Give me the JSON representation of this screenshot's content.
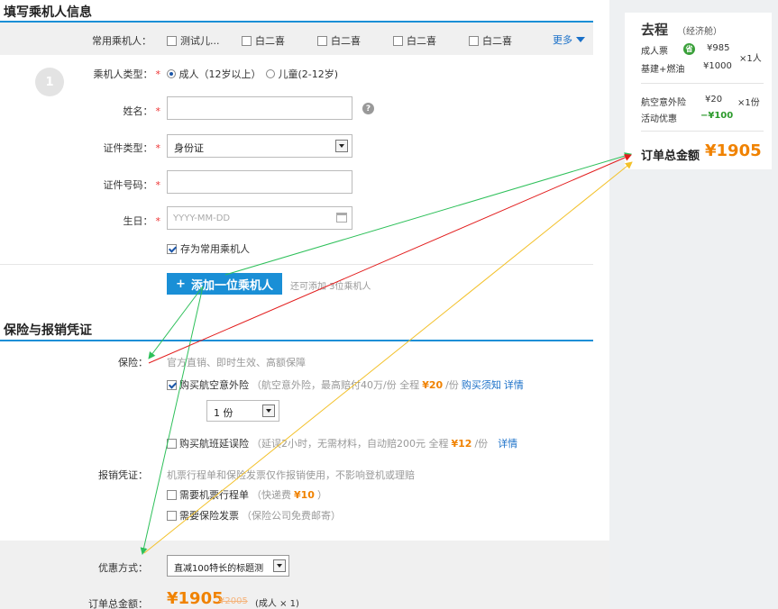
{
  "section1": {
    "title": "填写乘机人信息"
  },
  "frequent": {
    "label": "常用乘机人：",
    "items": [
      "测试儿...",
      "白二喜",
      "白二喜",
      "白二喜",
      "白二喜"
    ],
    "more": "更多"
  },
  "passenger": {
    "number": "1",
    "type_label": "乘机人类型：",
    "type_adult": "成人（12岁以上）",
    "type_child": "儿童(2-12岁)",
    "name_label": "姓名：",
    "help": "?",
    "idtype_label": "证件类型：",
    "idtype_value": "身份证",
    "idnum_label": "证件号码：",
    "birth_label": "生日：",
    "birth_placeholder": "YYYY-MM-DD",
    "save_label": "存为常用乘机人",
    "required_mark": "*"
  },
  "add": {
    "button": "添加一位乘机人",
    "plus": "+",
    "hint": "还可添加 3位乘机人"
  },
  "section2": {
    "title": "保险与报销凭证"
  },
  "insurance": {
    "label": "保险：",
    "desc": "官方直销、即时生效、高额保障",
    "accident_text": "购买航空意外险",
    "accident_desc": "（航空意外险，最高赔付40万/份 全程",
    "accident_price": "¥20",
    "accident_unit": "/份",
    "accident_notice": "购买须知",
    "accident_detail": "详情",
    "qty_value": "1 份",
    "delay_text": "购买航班延误险",
    "delay_desc": "（延误2小时，无需材料，自动赔200元 全程",
    "delay_price": "¥12",
    "delay_unit": "/份",
    "delay_detail": "详情"
  },
  "voucher": {
    "label": "报销凭证：",
    "desc": "机票行程单和保险发票仅作报销使用，不影响登机或理赔",
    "itinerary_text": "需要机票行程单",
    "itinerary_desc": "（快递费",
    "itinerary_price": "¥10",
    "itinerary_close": "）",
    "invoice_text": "需要保险发票",
    "invoice_desc": "（保险公司免费邮寄）"
  },
  "coupon": {
    "label": "优惠方式：",
    "value": "直减100特长的标题测"
  },
  "order_total": {
    "label": "订单总金额：",
    "price": "¥1905",
    "original": "¥2005",
    "note": "(成人 × 1)"
  },
  "side": {
    "title": "去程",
    "cabin": "（经济舱）",
    "adult_label": "成人票",
    "save_badge": "省",
    "adult_price": "¥985",
    "adult_qty": "×1人",
    "tax_label": "基建+燃油",
    "tax_price": "¥1000",
    "insurance_label": "航空意外险",
    "insurance_price": "¥20",
    "insurance_qty": "×1份",
    "discount_label": "活动优惠",
    "discount_value": "−¥100",
    "total_label": "订单总金额",
    "total_value": "¥1905"
  },
  "colors": {
    "accent": "#1a8fd6",
    "price": "#f08200",
    "arrow_green": "#2ec05a",
    "arrow_red": "#e21b1b",
    "arrow_yellow": "#f3c12a"
  }
}
